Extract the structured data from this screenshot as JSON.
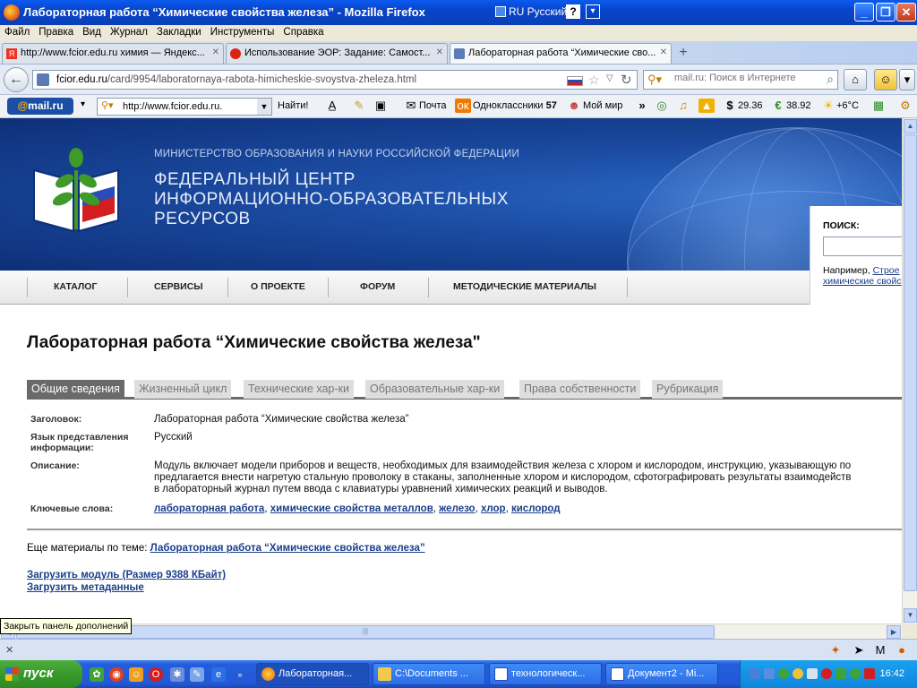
{
  "window": {
    "title": "Лабораторная работа “Химические свойства железа” - Mozilla Firefox",
    "language": "RU Русский",
    "help": "?"
  },
  "menu": [
    "Файл",
    "Правка",
    "Вид",
    "Журнал",
    "Закладки",
    "Инструменты",
    "Справка"
  ],
  "tabs": [
    {
      "label": "http://www.fcior.edu.ru химия — Яндекс..."
    },
    {
      "label": "Использование ЭОР: Задание: Самост..."
    },
    {
      "label": "Лабораторная работа “Химические сво..."
    }
  ],
  "nav": {
    "url_host": "fcior.edu.ru",
    "url_path": "/card/9954/laboratornaya-rabota-himicheskie-svoystva-zheleza.html",
    "search_placeholder": "mail.ru: Поиск в Интернете"
  },
  "mailbar": {
    "logo_at": "@",
    "logo_text": "mail.ru",
    "search_value": "http://www.fcior.edu.ru.",
    "find": "Найти!",
    "mail": "Почта",
    "ok": "Одноклассники",
    "ok_count": "57",
    "myworld": "Мой мир",
    "usd": "29.36",
    "eur": "38.92",
    "weather": "+6°C"
  },
  "site": {
    "ministry": "МИНИСТЕРСТВО ОБРАЗОВАНИЯ И НАУКИ РОССИЙСКОЙ ФЕДЕРАЦИИ",
    "center_line1": "ФЕДЕРАЛЬНЫЙ ЦЕНТР",
    "center_line2": "ИНФОРМАЦИОННО-ОБРАЗОВАТЕЛЬНЫХ",
    "center_line3": "РЕСУРСОВ",
    "search_label": "ПОИСК:",
    "search_example_prefix": "Например,",
    "search_example_link1": "Строе",
    "search_example_link2": "химические свойс"
  },
  "mainnav": [
    "КАТАЛОГ",
    "СЕРВИСЫ",
    "О ПРОЕКТЕ",
    "ФОРУМ",
    "МЕТОДИЧЕСКИЕ МАТЕРИАЛЫ"
  ],
  "page": {
    "heading": "Лабораторная работа “Химические свойства железа\"",
    "content_tabs": [
      "Общие сведения",
      "Жизненный цикл",
      "Технические хар-ки",
      "Образовательные хар-ки",
      "Права собственности",
      "Рубрикация"
    ],
    "fields": {
      "title_key": "Заголовок:",
      "title_val": "Лабораторная работа “Химические свойства железа”",
      "lang_key": "Язык представления информации:",
      "lang_val": "Русский",
      "desc_key": "Описание:",
      "desc_line1": "Модуль включает модели приборов и веществ, необходимых для взаимодействия железа с хлором и кислородом, инструкцию, указывающую по",
      "desc_line2": "предлагается внести нагретую стальную проволоку в стаканы, заполненные хлором и кислородом, сфотографировать результаты взаимодейств",
      "desc_line3": "в лабораторный журнал путем ввода с клавиатуры уравнений химических реакций и выводов.",
      "keywords_key": "Ключевые слова:",
      "keywords": [
        "лабораторная работа",
        "химические свойства металлов",
        "железо",
        "хлор",
        "кислород"
      ]
    },
    "more_prefix": "Еще материалы по теме:",
    "more_link": "Лабораторная работа “Химические свойства железа”",
    "download_module": "Загрузить модуль (Размер 9388 КБайт)",
    "download_meta": "Загрузить метаданные"
  },
  "tooltip": "Закрыть панель дополнений",
  "taskbar": {
    "start": "пуск",
    "tasks": [
      {
        "label": "Лабораторная..."
      },
      {
        "label": "C:\\Documents ..."
      },
      {
        "label": "технологическ..."
      },
      {
        "label": "Документ2 - Mi..."
      }
    ],
    "clock": "16:42"
  }
}
